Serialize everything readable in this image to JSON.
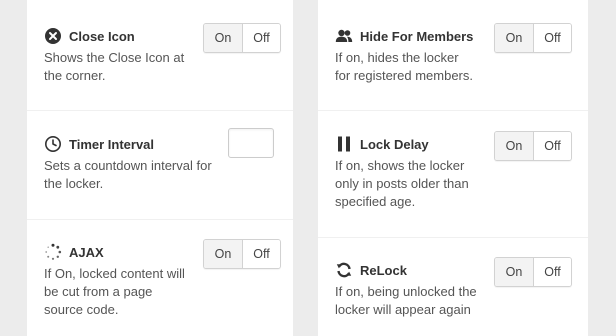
{
  "left_column": {
    "close_icon": {
      "icon": "close-circle-icon",
      "title": "Close Icon",
      "desc": [
        "Shows the Close Icon at",
        "the corner."
      ],
      "toggle": {
        "on": "On",
        "off": "Off"
      }
    },
    "timer_interval": {
      "icon": "timer-icon",
      "title": "Timer Interval",
      "desc": [
        "Sets a countdown interval for",
        "the locker."
      ],
      "value": ""
    },
    "ajax": {
      "icon": "spinner-icon",
      "title": "AJAX",
      "desc": [
        "If On, locked content will",
        "be cut from a page",
        "source code."
      ],
      "toggle": {
        "on": "On",
        "off": "Off"
      }
    }
  },
  "right_column": {
    "hide_for_members": {
      "icon": "users-icon",
      "title": "Hide For Members",
      "desc": [
        "If on, hides the locker",
        "for registered members."
      ],
      "toggle": {
        "on": "On",
        "off": "Off"
      }
    },
    "lock_delay": {
      "icon": "pause-icon",
      "title": "Lock Delay",
      "desc": [
        "If on, shows the locker",
        "only in posts older than",
        "specified age."
      ],
      "toggle": {
        "on": "On",
        "off": "Off"
      }
    },
    "relock": {
      "icon": "refresh-icon",
      "title": "ReLock",
      "desc": [
        "If on, being unlocked the",
        "locker will appear again"
      ],
      "toggle": {
        "on": "On",
        "off": "Off"
      }
    }
  },
  "colors": {
    "text": "#333333",
    "background": "#ececec",
    "panel": "#ffffff",
    "toggle_active": "#f3f3f3"
  }
}
